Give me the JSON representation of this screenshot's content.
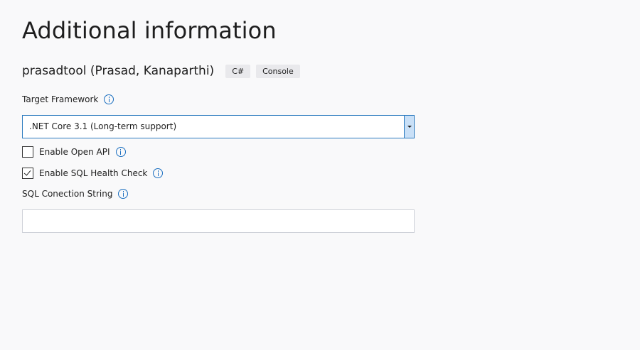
{
  "page": {
    "title": "Additional information"
  },
  "template": {
    "name": "prasadtool (Prasad, Kanaparthi)",
    "tags": [
      "C#",
      "Console"
    ]
  },
  "target_framework": {
    "label": "Target Framework",
    "selected": ".NET Core 3.1 (Long-term support)"
  },
  "options": {
    "open_api": {
      "label": "Enable Open API",
      "checked": false
    },
    "sql_health_check": {
      "label": "Enable SQL Health Check",
      "checked": true
    }
  },
  "sql_connection": {
    "label": "SQL Conection String",
    "value": ""
  },
  "colors": {
    "background": "#f9f9fa",
    "accent": "#1b6fc0",
    "dropdown_border": "#2c7bbf",
    "tag_background": "#e9e9ec"
  }
}
